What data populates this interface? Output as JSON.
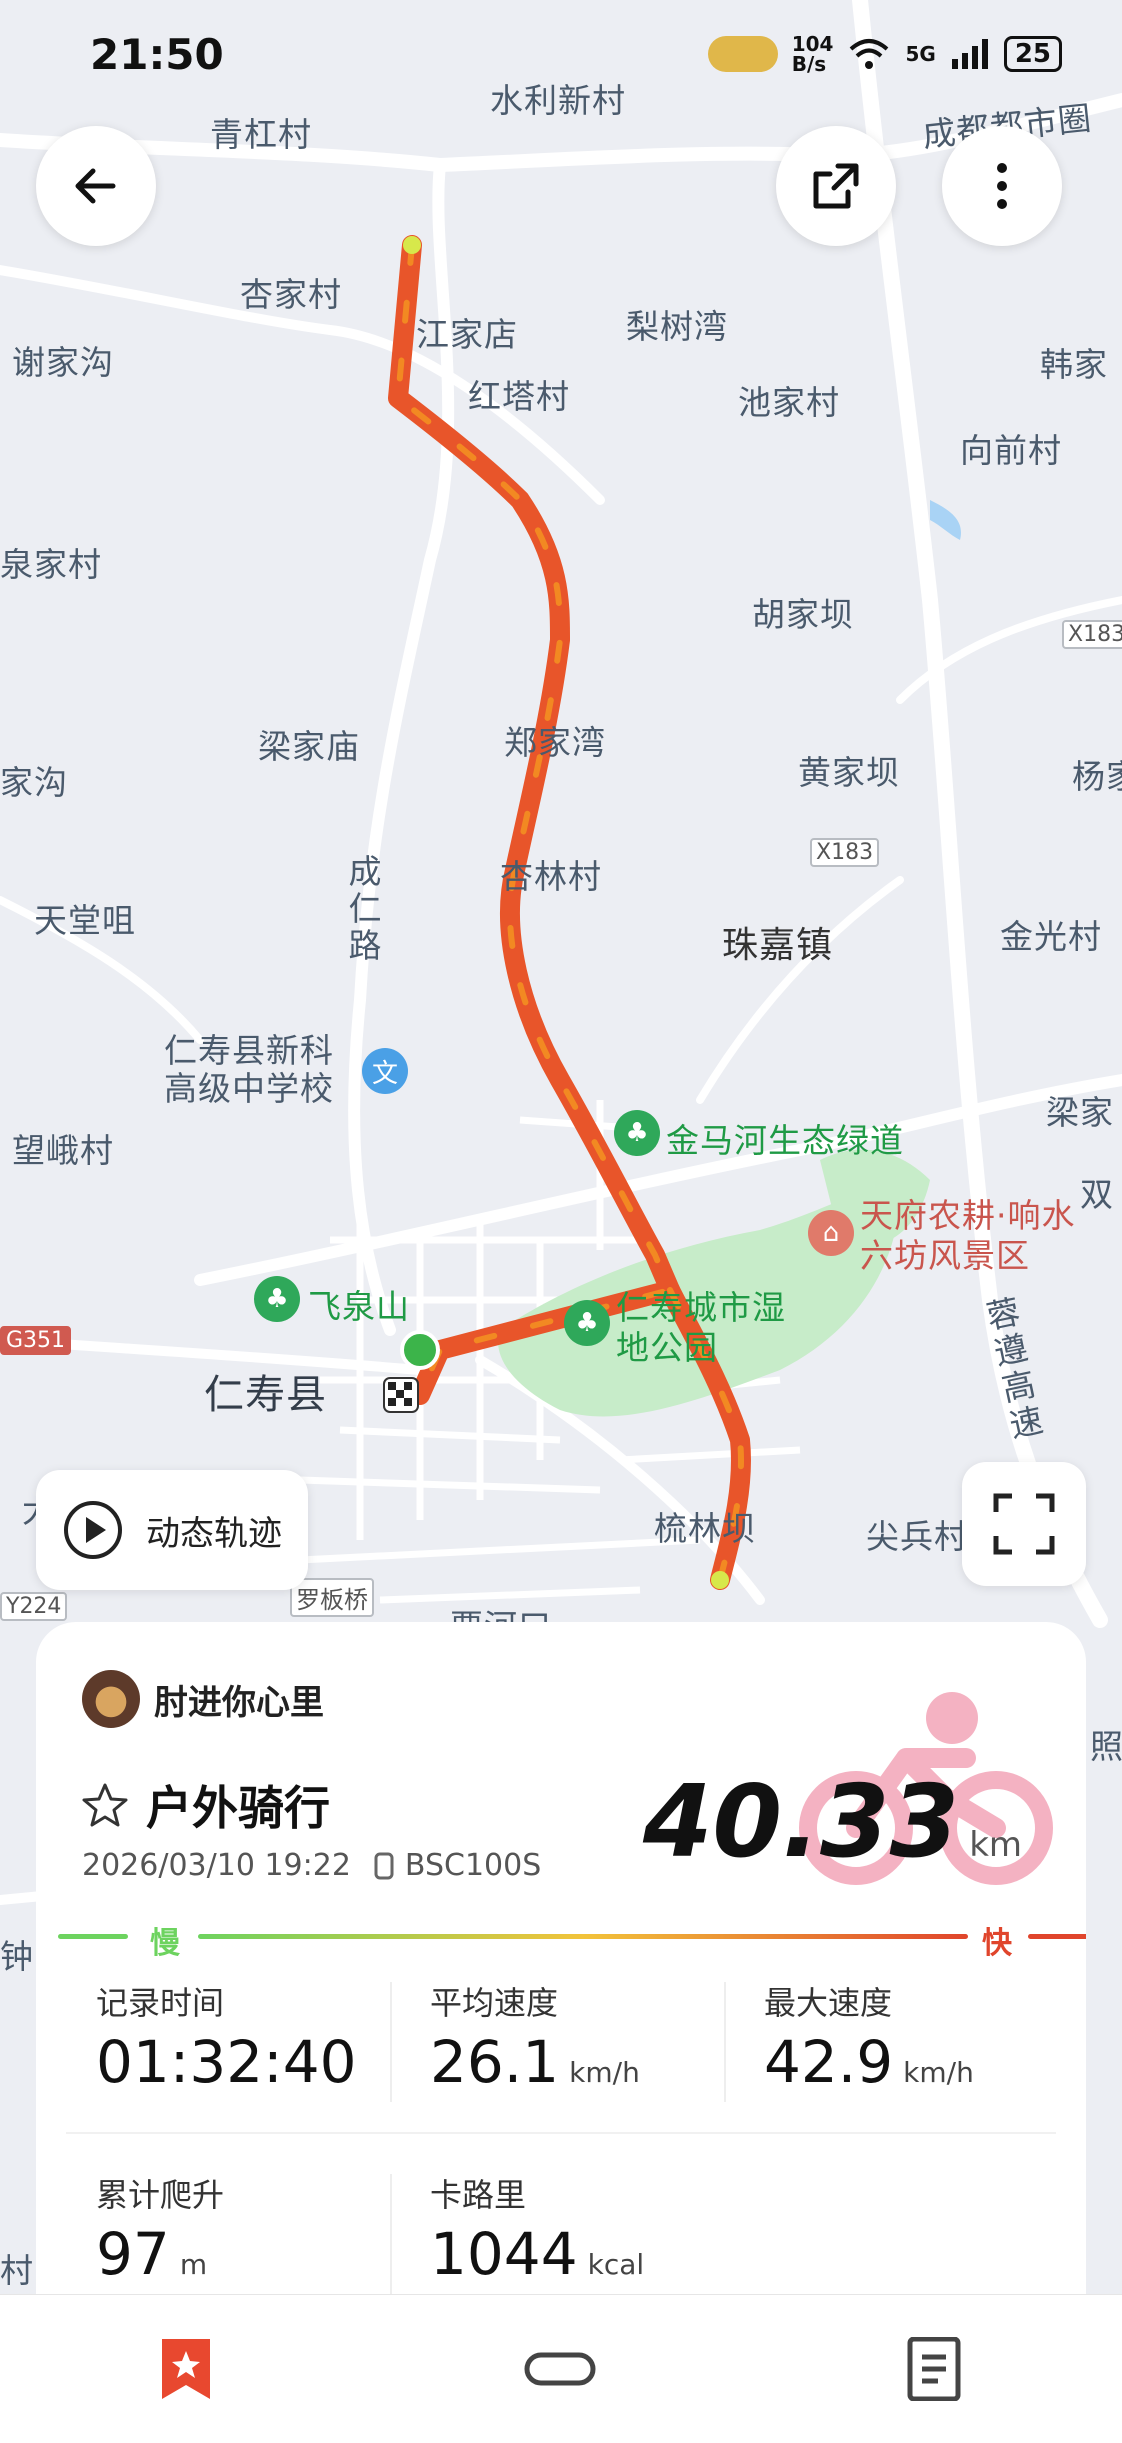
{
  "status_bar": {
    "time": "21:50",
    "net_speed_value": "104",
    "net_speed_unit": "B/s",
    "network": "5G",
    "battery": "25"
  },
  "map": {
    "places": [
      "水利新村",
      "青杠村",
      "成都都市圈",
      "杏家村",
      "江家店",
      "梨树湾",
      "红塔村",
      "池家村",
      "韩家",
      "谢家沟",
      "向前村",
      "泉家村",
      "胡家坝",
      "梁家庙",
      "郑家湾",
      "黄家坝",
      "杨家",
      "家沟",
      "天堂咀",
      "珠嘉镇",
      "金光村",
      "杏林村",
      "成仁路",
      "仁寿县新科高级中学校",
      "望峨村",
      "梁家",
      "双",
      "飞泉山",
      "仁寿县",
      "梳林坝",
      "尖兵村",
      "罗板桥",
      "照",
      "钟",
      "蓉遵高速",
      "村",
      "大",
      "贾河口",
      "金马河生态绿道",
      "天府农耕·响水六坊风景区",
      "仁寿城市湿地公园"
    ],
    "road_tags": [
      "X183",
      "X183",
      "G351",
      "Y224"
    ]
  },
  "map_controls": {
    "dynamic_track_label": "动态轨迹"
  },
  "summary": {
    "username": "肘进你心里",
    "activity": "户外骑行",
    "datetime": "2026/03/10 19:22",
    "device": "BSC100S",
    "distance": "40.33",
    "distance_unit": "km",
    "slow_label": "慢",
    "fast_label": "快",
    "stats": [
      {
        "label": "记录时间",
        "value": "01:32:40",
        "unit": ""
      },
      {
        "label": "平均速度",
        "value": "26.1",
        "unit": "km/h"
      },
      {
        "label": "最大速度",
        "value": "42.9",
        "unit": "km/h"
      },
      {
        "label": "累计爬升",
        "value": "97",
        "unit": "m"
      },
      {
        "label": "卡路里",
        "value": "1044",
        "unit": "kcal"
      }
    ]
  },
  "colors": {
    "track": "#f06a1a",
    "accent": "#e8482f",
    "slow": "#6dd35f",
    "fast": "#e0452c"
  },
  "icons": [
    "back-icon",
    "share-icon",
    "more-icon",
    "play-icon",
    "fullscreen-icon",
    "star-icon",
    "device-icon",
    "bookmark-icon",
    "watch-icon",
    "list-icon"
  ]
}
